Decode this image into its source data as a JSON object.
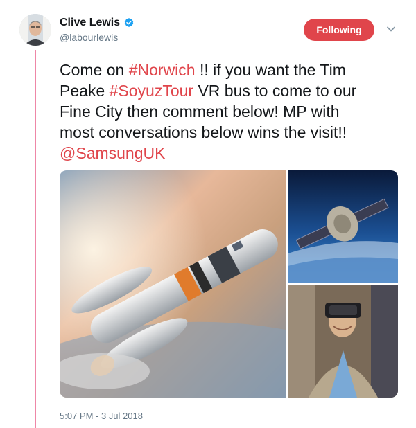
{
  "tweet": {
    "author": {
      "display_name": "Clive Lewis",
      "handle": "@labourlewis",
      "verified": true,
      "avatar_icon": "profile-photo"
    },
    "follow_button_label": "Following",
    "more_menu_icon": "chevron-down-icon",
    "text_lines": [
      [
        {
          "text": "Come on ",
          "link": false
        },
        {
          "text": "#Norwich",
          "link": true
        },
        {
          "text": " !! if you want the Tim",
          "link": false
        }
      ],
      [
        {
          "text": "Peake ",
          "link": false
        },
        {
          "text": "#SoyuzTour",
          "link": true
        },
        {
          "text": " VR bus to come to our",
          "link": false
        }
      ],
      [
        {
          "text": "Fine City then comment below! MP with",
          "link": false
        }
      ],
      [
        {
          "text": "most conversations below wins the visit!!",
          "link": false
        }
      ],
      [
        {
          "text": "@SamsungUK",
          "link": true
        }
      ]
    ],
    "media": [
      {
        "name": "soyuz-rocket-photo"
      },
      {
        "name": "spacecraft-over-earth-photo"
      },
      {
        "name": "vr-headset-person-photo"
      }
    ],
    "timestamp": "5:07 PM - 3 Jul 2018"
  },
  "colors": {
    "accent": "#e0454b",
    "verified_badge": "#1da1f2",
    "secondary_text": "#657786",
    "primary_text": "#14171a"
  }
}
